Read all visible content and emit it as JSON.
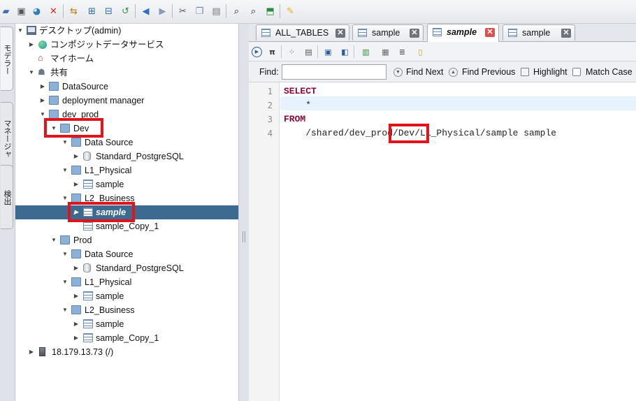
{
  "toolbar": {
    "icons": [
      "folder-open-icon",
      "save-icon",
      "save-as-icon",
      "delete-icon",
      "refresh-icon",
      "add-icon",
      "remove-icon",
      "undo-icon",
      "back-icon",
      "forward-icon",
      "cut-icon",
      "copy-icon",
      "paste-icon",
      "find-icon",
      "find-in-tree-icon",
      "open-icon",
      "note-icon"
    ]
  },
  "side_tabs": [
    "モデラー",
    "マネージャ",
    "検出"
  ],
  "tree": {
    "rows": [
      {
        "label": "デスクトップ(admin)"
      },
      {
        "label": "コンポジットデータサービス"
      },
      {
        "label": "マイホーム"
      },
      {
        "label": "共有"
      },
      {
        "label": "DataSource"
      },
      {
        "label": "deployment manager"
      },
      {
        "label": "dev_prod"
      },
      {
        "label": "Dev"
      },
      {
        "label": "Data Source"
      },
      {
        "label": "Standard_PostgreSQL"
      },
      {
        "label": "L1_Physical"
      },
      {
        "label": "sample"
      },
      {
        "label": "L2_Business"
      },
      {
        "label": "sample"
      },
      {
        "label": "sample_Copy_1"
      },
      {
        "label": "Prod"
      },
      {
        "label": "Data Source"
      },
      {
        "label": "Standard_PostgreSQL"
      },
      {
        "label": "L1_Physical"
      },
      {
        "label": "sample"
      },
      {
        "label": "L2_Business"
      },
      {
        "label": "sample"
      },
      {
        "label": "sample_Copy_1"
      },
      {
        "label": "18.179.13.73 (/)"
      }
    ],
    "selected_index": 13
  },
  "editor_tabs": [
    {
      "label": "ALL_TABLES",
      "active": false
    },
    {
      "label": "sample",
      "active": false
    },
    {
      "label": "sample",
      "active": true
    },
    {
      "label": "sample",
      "active": false
    }
  ],
  "find_bar": {
    "find_label": "Find:",
    "find_value": "",
    "find_next": "Find Next",
    "find_previous": "Find Previous",
    "highlight": "Highlight",
    "match_case": "Match Case"
  },
  "code": {
    "line_numbers": [
      "1",
      "2",
      "3",
      "4"
    ],
    "lines": [
      "SELECT",
      "    *",
      "FROM",
      "    /shared/dev_prod/Dev/L1_Physical/sample sample"
    ],
    "current_line": 2
  },
  "colors": {
    "selection": "#3d6a91",
    "highlight_box": "#e0141a",
    "keyword": "#8b0a3a"
  }
}
